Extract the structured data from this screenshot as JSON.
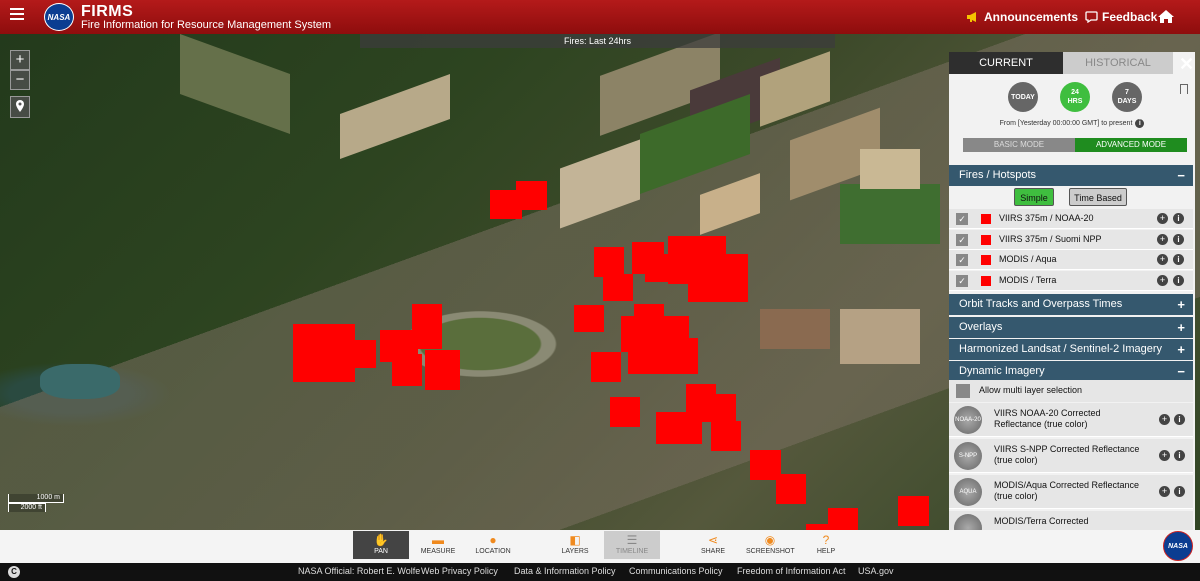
{
  "header": {
    "title": "FIRMS",
    "subtitle": "Fire Information for Resource Management System",
    "logo_text": "NASA",
    "announcements": "Announcements",
    "feedback": "Feedback"
  },
  "map": {
    "fires_banner": "Fires: Last 24hrs",
    "zoom_in": "+",
    "zoom_out": "−",
    "scale_metric": "1000 m",
    "scale_imperial": "2000 ft"
  },
  "panel": {
    "tabs": {
      "current": "CURRENT",
      "historical": "HISTORICAL"
    },
    "time_buttons": {
      "today": "TODAY",
      "hrs24_a": "24",
      "hrs24_b": "HRS",
      "days7_a": "7",
      "days7_b": "DAYS"
    },
    "range_text": "From [Yesterday 00:00:00 GMT] to present",
    "modes": {
      "basic": "BASIC MODE",
      "advanced": "ADVANCED MODE"
    },
    "sections": {
      "fires": "Fires / Hotspots",
      "orbit": "Orbit Tracks and Overpass Times",
      "overlays": "Overlays",
      "harmonized": "Harmonized Landsat / Sentinel-2 Imagery",
      "dynamic": "Dynamic Imagery"
    },
    "fire_modes": {
      "simple": "Simple",
      "time_based": "Time Based"
    },
    "fire_layers": [
      {
        "label": "VIIRS 375m / NOAA-20"
      },
      {
        "label": "VIIRS 375m / Suomi NPP"
      },
      {
        "label": "MODIS / Aqua"
      },
      {
        "label": "MODIS / Terra"
      }
    ],
    "multi_layer_label": "Allow multi layer selection",
    "imagery": [
      {
        "thumb": "NOAA-20",
        "label": "VIIRS NOAA-20 Corrected Reflectance (true color)"
      },
      {
        "thumb": "S-NPP",
        "label": "VIIRS S-NPP Corrected Reflectance (true color)"
      },
      {
        "thumb": "AQUA",
        "label": "MODIS/Aqua Corrected Reflectance (true color)"
      },
      {
        "thumb": "",
        "label": "MODIS/Terra Corrected"
      }
    ]
  },
  "toolbar": {
    "pan": "PAN",
    "measure": "MEASURE",
    "location": "LOCATION",
    "layers": "LAYERS",
    "timeline": "TIMELINE",
    "share": "SHARE",
    "screenshot": "SCREENSHOT",
    "help": "HELP",
    "badge": "NASA"
  },
  "footer": {
    "cc": "C",
    "links": [
      "NASA Official: Robert E. Wolfe",
      "Web Privacy Policy",
      "Data & Information Policy",
      "Communications Policy",
      "Freedom of Information Act",
      "USA.gov"
    ]
  },
  "colors": {
    "header_red": "#a61414",
    "fire_red": "#ff0000",
    "active_green": "#3fbe3f",
    "section_blue": "#35586e"
  }
}
